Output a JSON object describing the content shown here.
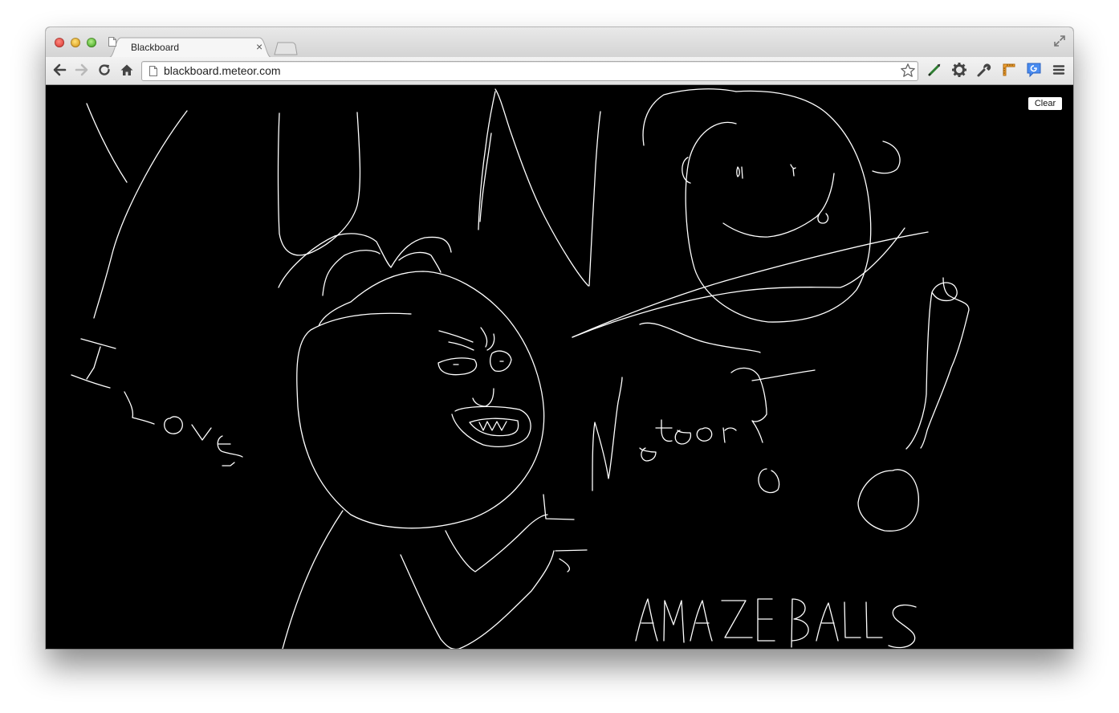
{
  "window": {
    "tab_title": "Blackboard",
    "tab_close_glyph": "×"
  },
  "toolbar": {
    "url": "blackboard.meteor.com",
    "icons": [
      "back-arrow-icon",
      "forward-arrow-icon",
      "reload-icon",
      "home-icon",
      "bookmark-star-icon",
      "pen-extension-icon",
      "gear-icon",
      "wrench-icon",
      "ruler-extension-icon",
      "translate-extension-icon",
      "menu-icon"
    ]
  },
  "blackboard": {
    "clear_label": "Clear",
    "background": "#000000",
    "ink_color": "#ffffff"
  }
}
